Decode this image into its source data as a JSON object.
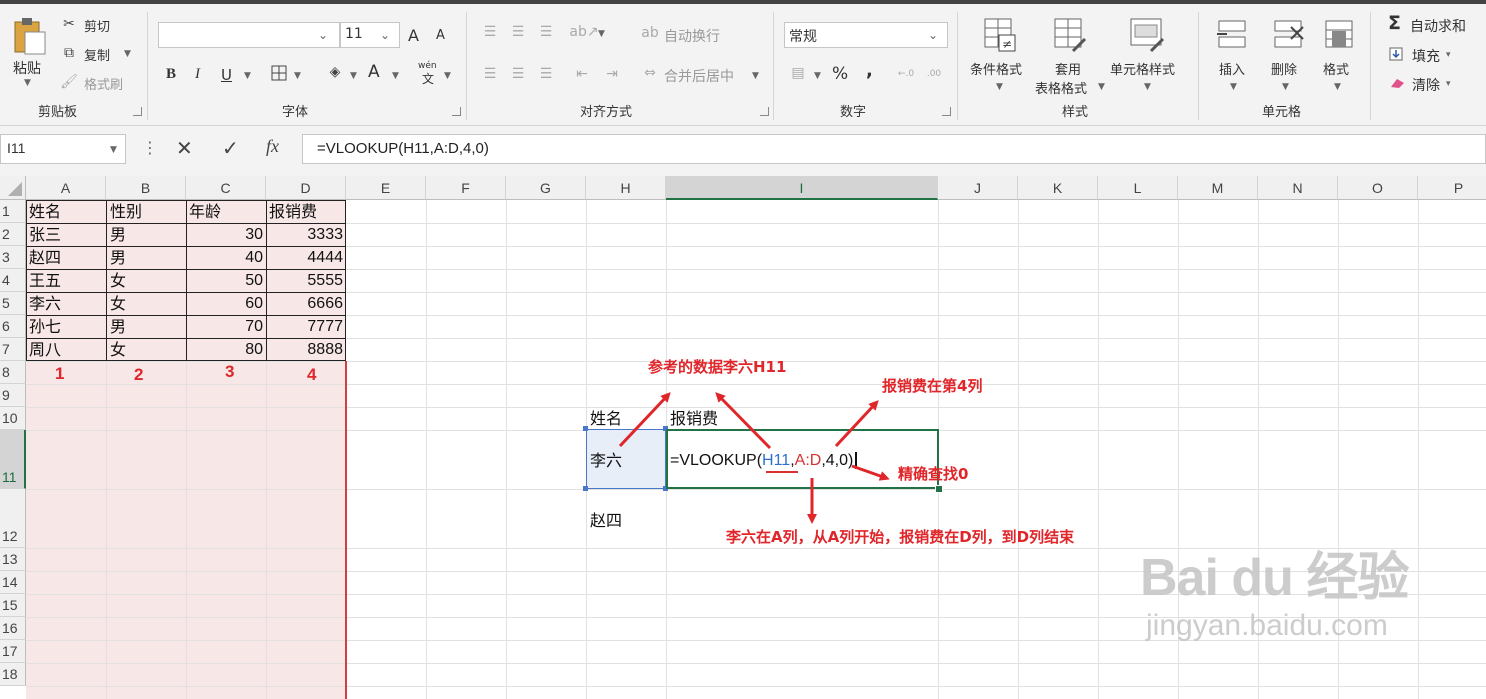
{
  "ribbon": {
    "clipboard": {
      "paste": "粘贴",
      "cut": "剪切",
      "copy": "复制",
      "format_painter": "格式刷",
      "label": "剪贴板"
    },
    "font": {
      "font_name": "",
      "font_size": "11",
      "bold": "B",
      "italic": "I",
      "underline": "U",
      "font_color": "A",
      "grow": "A",
      "shrink": "A",
      "wen": "wén",
      "label": "字体"
    },
    "alignment": {
      "wrap_text": "自动换行",
      "merge_center": "合并后居中",
      "label": "对齐方式"
    },
    "number": {
      "format": "常规",
      "percent": "%",
      "comma": ",",
      "label": "数字"
    },
    "styles": {
      "conditional": "条件格式",
      "table_line1": "套用",
      "table_line2": "表格格式",
      "cell_styles": "单元格样式",
      "label": "样式"
    },
    "cells": {
      "insert": "插入",
      "delete": "删除",
      "format": "格式",
      "label": "单元格"
    },
    "editing": {
      "autosum": "自动求和",
      "fill": "填充",
      "clear": "清除"
    }
  },
  "formula_bar": {
    "name_box": "I11",
    "formula": "=VLOOKUP(H11,A:D,4,0)"
  },
  "columns": [
    "A",
    "B",
    "C",
    "D",
    "E",
    "F",
    "G",
    "H",
    "I",
    "J",
    "K",
    "L",
    "M",
    "N",
    "O",
    "P"
  ],
  "rows": [
    "1",
    "2",
    "3",
    "4",
    "5",
    "6",
    "7",
    "8",
    "9",
    "10",
    "11",
    "12",
    "13",
    "14",
    "15",
    "16",
    "17",
    "18"
  ],
  "table": {
    "headers": [
      "姓名",
      "性别",
      "年龄",
      "报销费"
    ],
    "rows": [
      [
        "张三",
        "男",
        "30",
        "3333"
      ],
      [
        "赵四",
        "男",
        "40",
        "4444"
      ],
      [
        "王五",
        "女",
        "50",
        "5555"
      ],
      [
        "李六",
        "女",
        "60",
        "6666"
      ],
      [
        "孙七",
        "男",
        "70",
        "7777"
      ],
      [
        "周八",
        "女",
        "80",
        "8888"
      ]
    ],
    "column_numbers": [
      "1",
      "2",
      "3",
      "4"
    ]
  },
  "lookup": {
    "h10": "姓名",
    "i10": "报销费",
    "h11": "李六",
    "h12": "赵四",
    "formula_prefix": "=VLOOKUP(",
    "arg1": "H11",
    "sep1": ",",
    "arg2": "A:D",
    "rest": ",4,0)"
  },
  "annotations": {
    "ref": "参考的数据李六H11",
    "col4": "报销费在第4列",
    "exact": "精确查找0",
    "range": "李六在A列，从A列开始，报销费在D列，到D列结束"
  },
  "watermark": {
    "brand": "Bai du 经验",
    "url": "jingyan.baidu.com"
  },
  "colors": {
    "accent": "#217346",
    "annotation": "#e0262a",
    "table_fill": "#f8e7e7",
    "ref_blue": "#2f6fd0",
    "ref_red": "#d93030"
  }
}
